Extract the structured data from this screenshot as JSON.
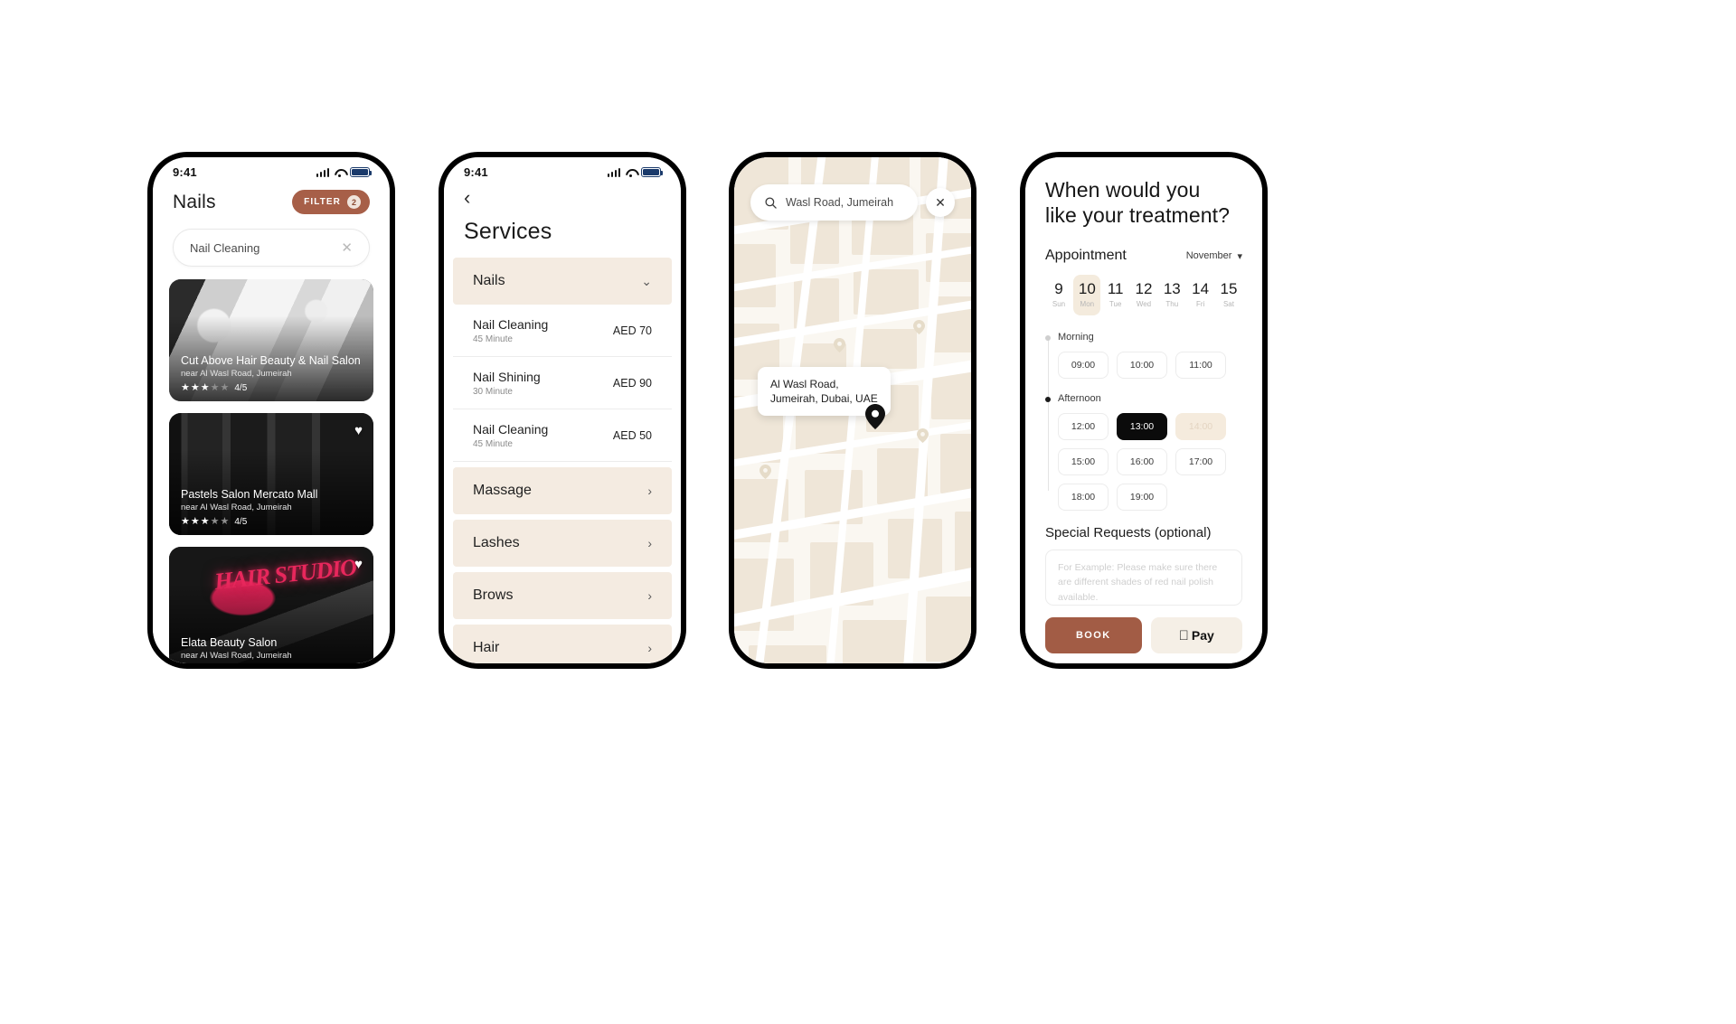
{
  "theme": {
    "accent_brown": "#a25c45",
    "beige": "#f4ebe1",
    "map_land": "#efe6d8",
    "map_bg": "#faf7f1",
    "selected_black": "#0b0b0b"
  },
  "statusbar": {
    "time": "9:41",
    "icons": [
      "signal-icon",
      "wifi-icon",
      "battery-icon"
    ]
  },
  "phone1": {
    "title": "Nails",
    "filter": {
      "label": "FILTER",
      "count": "2"
    },
    "search": {
      "value": "Nail Cleaning",
      "clear": "✕"
    },
    "cards": [
      {
        "name": "Cut Above Hair Beauty & Nail Salon",
        "near": "near Al Wasl Road, Jumeirah",
        "stars_on": 3,
        "stars_off": 2,
        "rating": "4/5",
        "favorite": false
      },
      {
        "name": "Pastels Salon Mercato Mall",
        "near": "near Al Wasl Road, Jumeirah",
        "stars_on": 3,
        "stars_off": 2,
        "rating": "4/5",
        "favorite": true
      },
      {
        "name": "Elata Beauty Salon",
        "near": "near Al Wasl Road, Jumeirah",
        "stars_on": 0,
        "stars_off": 0,
        "rating": "",
        "favorite": true,
        "neon_text": "HAIR STUDIO"
      }
    ]
  },
  "phone2": {
    "back": "‹",
    "title": "Services",
    "rows": [
      {
        "kind": "group",
        "label": "Nails",
        "chevron": "chevron-down-icon",
        "expanded": true
      },
      {
        "kind": "item",
        "name": "Nail Cleaning",
        "duration": "45 Minute",
        "price": "AED 70"
      },
      {
        "kind": "item",
        "name": "Nail Shining",
        "duration": "30 Minute",
        "price": "AED 90"
      },
      {
        "kind": "item",
        "name": "Nail Cleaning",
        "duration": "45 Minute",
        "price": "AED 50"
      },
      {
        "kind": "group",
        "label": "Massage",
        "chevron": "chevron-right-icon",
        "expanded": false
      },
      {
        "kind": "group",
        "label": "Lashes",
        "chevron": "chevron-right-icon",
        "expanded": false
      },
      {
        "kind": "group",
        "label": "Brows",
        "chevron": "chevron-right-icon",
        "expanded": false
      },
      {
        "kind": "group",
        "label": "Hair",
        "chevron": "chevron-right-icon",
        "expanded": false
      }
    ]
  },
  "phone3": {
    "search": {
      "value": "Wasl Road, Jumeirah",
      "icon": "search-icon"
    },
    "close": "✕",
    "callout": "Al Wasl Road,\nJumeirah, Dubai, UAE",
    "callout_line1": "Al Wasl Road,",
    "callout_line2": "Jumeirah, Dubai, UAE",
    "pins": 4
  },
  "phone4": {
    "heading_line1": "When would you",
    "heading_line2": "like your treatment?",
    "appointment_label": "Appointment",
    "month": "November",
    "month_caret": "▾",
    "dates": [
      {
        "d": "9",
        "w": "Sun",
        "selected": false
      },
      {
        "d": "10",
        "w": "Mon",
        "selected": true
      },
      {
        "d": "11",
        "w": "Tue",
        "selected": false
      },
      {
        "d": "12",
        "w": "Wed",
        "selected": false
      },
      {
        "d": "13",
        "w": "Thu",
        "selected": false
      },
      {
        "d": "14",
        "w": "Fri",
        "selected": false
      },
      {
        "d": "15",
        "w": "Sat",
        "selected": false
      }
    ],
    "morning_label": "Morning",
    "morning_slots": [
      {
        "t": "09:00",
        "state": "normal"
      },
      {
        "t": "10:00",
        "state": "normal"
      },
      {
        "t": "11:00",
        "state": "normal"
      }
    ],
    "afternoon_label": "Afternoon",
    "afternoon_slots": [
      {
        "t": "12:00",
        "state": "normal"
      },
      {
        "t": "13:00",
        "state": "selected"
      },
      {
        "t": "14:00",
        "state": "disabled"
      },
      {
        "t": "15:00",
        "state": "normal"
      },
      {
        "t": "16:00",
        "state": "normal"
      },
      {
        "t": "17:00",
        "state": "normal"
      },
      {
        "t": "18:00",
        "state": "normal"
      },
      {
        "t": "19:00",
        "state": "normal"
      }
    ],
    "special_title": "Special Requests (optional)",
    "special_placeholder": "For Example: Please make sure there are different shades of red nail polish available.",
    "book_label": "BOOK",
    "pay_label": "Pay",
    "pay_icon": "apple-logo-icon"
  }
}
